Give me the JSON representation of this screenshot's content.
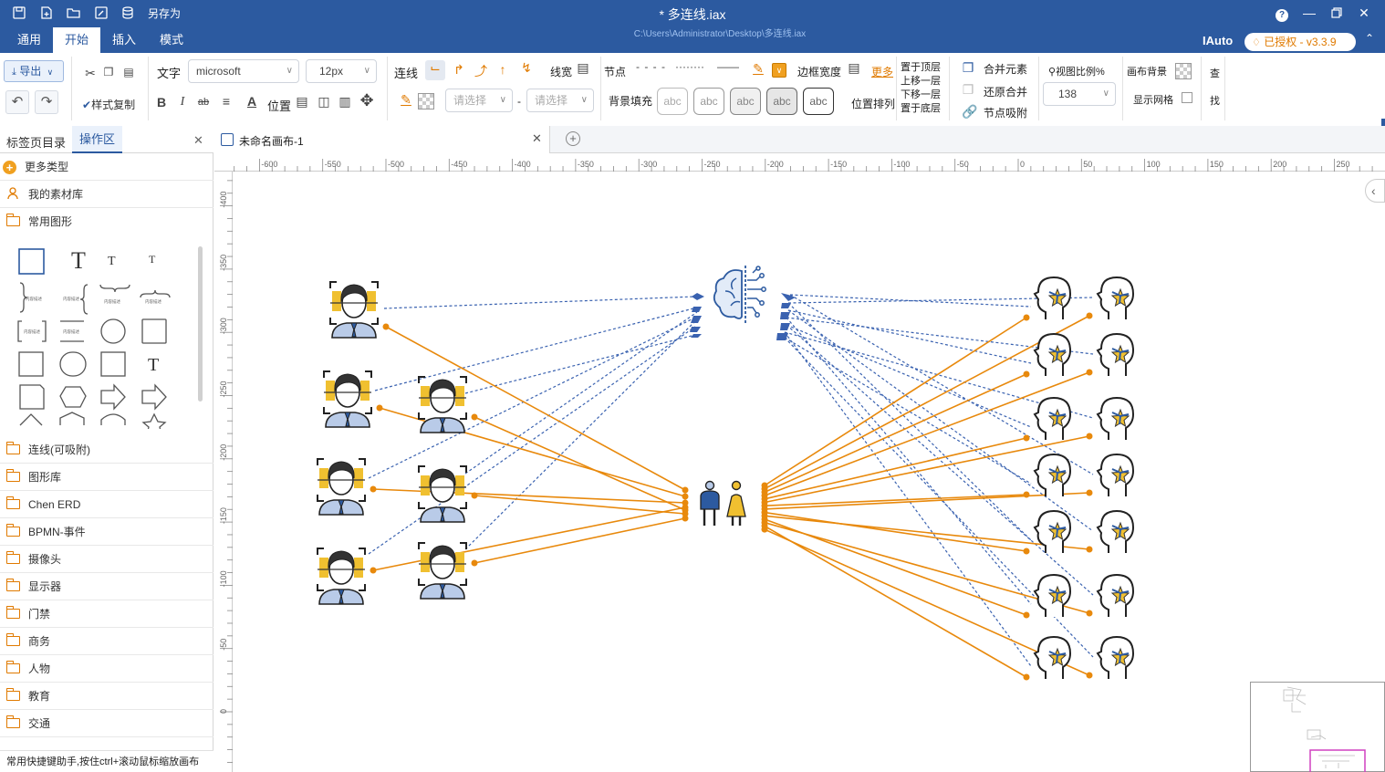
{
  "app": {
    "title": "* 多连线.iax",
    "file_path": "C:\\Users\\Administrator\\Desktop\\多连线.iax",
    "save_as": "另存为",
    "user": "IAuto",
    "license": "已授权 - v3.3.9",
    "help": "?"
  },
  "menus": [
    "通用",
    "开始",
    "插入",
    "模式"
  ],
  "ribbon": {
    "export": "导出",
    "text_label": "文字",
    "font_family": "microsoft",
    "font_size": "12px",
    "style_copy": "样式复制",
    "bold": "B",
    "italic": "I",
    "strike": "ab",
    "font_color": "A",
    "position": "位置",
    "connector": "连线",
    "line_width": "线宽",
    "node": "节点",
    "select_1": "请选择",
    "select_2": "请选择",
    "dash": "-",
    "bg_fill": "背景填充",
    "abc": [
      "abc",
      "abc",
      "abc",
      "abc",
      "abc"
    ],
    "border_width": "边框宽度",
    "more": "更多",
    "position_arrange": "位置排列",
    "layer": [
      "置于顶层",
      "上移一层",
      "下移一层",
      "置于底层"
    ],
    "merge": "合并元素",
    "unmerge": "还原合并",
    "snap": "节点吸附",
    "zoom_label": "视图比例%",
    "zoom_value": "138",
    "canvas_bg": "画布背景",
    "show_grid": "显示网格",
    "find_1": "查",
    "find_2": "找"
  },
  "left_panel": {
    "tabs": [
      "标签页目录",
      "操作区"
    ],
    "more_types": "更多类型",
    "my_library": "我的素材库",
    "common_shapes": "常用图形",
    "categories": [
      "连线(可吸附)",
      "图形库",
      "Chen ERD",
      "BPMN-事件",
      "摄像头",
      "显示器",
      "门禁",
      "商务",
      "人物",
      "教育",
      "交通"
    ],
    "status": "常用快捷键助手,按住ctrl+滚动鼠标缩放画布"
  },
  "canvas_tab": {
    "name": "未命名画布-1"
  },
  "ruler": {
    "h_ticks": [
      "-600",
      "-550",
      "-500",
      "-450",
      "-400",
      "-350",
      "-300",
      "-250",
      "-200",
      "-150",
      "-100",
      "-50",
      "0",
      "50",
      "100",
      "150",
      "200",
      "250"
    ],
    "v_ticks": [
      "-400",
      "-350",
      "-300",
      "-250",
      "-200",
      "-150",
      "-100",
      "-50",
      "0"
    ]
  },
  "colors": {
    "primary": "#2c5aa0",
    "orange": "#e8890c",
    "dashed_blue": "#3a62b0"
  }
}
